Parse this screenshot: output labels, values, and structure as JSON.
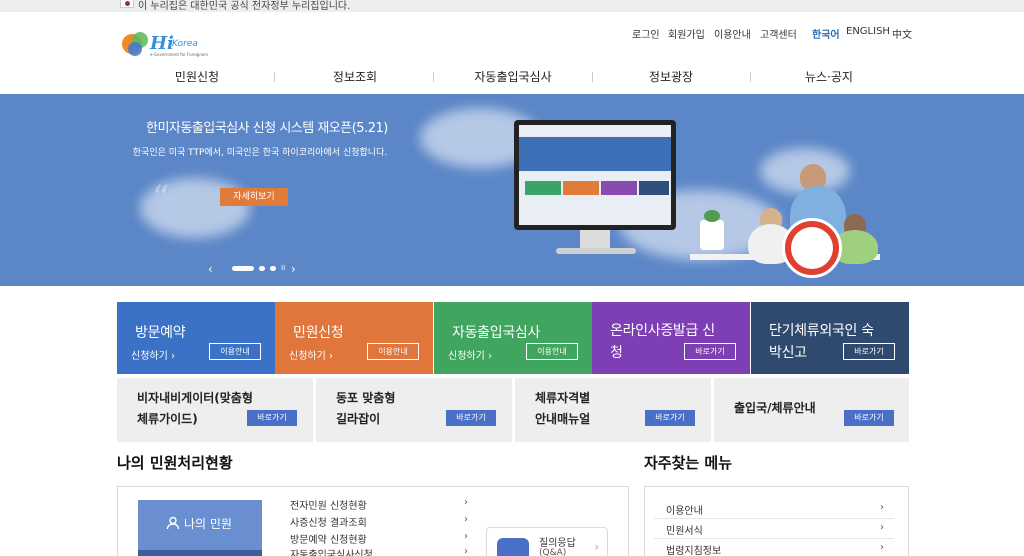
{
  "gov_notice": "이 누리집은 대한민국 공식 전자정부 누리집입니다.",
  "logo": {
    "mark": "Hi",
    "name": "Korea",
    "tagline": "e-Government for Foreigners"
  },
  "utility_links": [
    "로그인",
    "회원가입",
    "이용안내",
    "고객센터"
  ],
  "languages": [
    "한국어",
    "ENGLISH",
    "中文"
  ],
  "active_language": "한국어",
  "gnb": [
    "민원신청",
    "정보조회",
    "자동출입국심사",
    "정보광장",
    "뉴스·공지"
  ],
  "hero": {
    "title": "한미자동출입국심사 신청 시스템 재오픈(5.21)",
    "description": "한국인은 미국 TTP에서, 미국인은 한국 하이코리아에서 신청합니다.",
    "button": "자세히보기",
    "prev": "‹",
    "next": "›",
    "pause": "II",
    "slide_count": 3,
    "active_slide": 1
  },
  "tiles": [
    {
      "title": "방문예약",
      "link": "신청하기 ›",
      "button": "이용안내",
      "color": "#3b72c6"
    },
    {
      "title": "민원신청",
      "link": "신청하기 ›",
      "button": "이용안내",
      "color": "#e0763b"
    },
    {
      "title": "자동출입국심사",
      "link": "신청하기 ›",
      "button": "이용안내",
      "color": "#3fa55f"
    },
    {
      "title": "온라인사증발급 신청",
      "link": "",
      "button": "바로가기",
      "color": "#7f3fb4"
    },
    {
      "title": "단기체류외국인 숙박신고",
      "link": "",
      "button": "바로가기",
      "color": "#2f4a6e"
    }
  ],
  "guides": [
    {
      "title": [
        "비자내비게이터(맞춤형",
        "체류가이드)"
      ],
      "button": "바로가기"
    },
    {
      "title": [
        "동포 맞춤형",
        "길라잡이"
      ],
      "button": "바로가기"
    },
    {
      "title": [
        "체류자격별",
        "안내매뉴얼"
      ],
      "button": "바로가기"
    },
    {
      "title": [
        "출입국/체류안내"
      ],
      "button": "바로가기"
    }
  ],
  "my_status": {
    "title": "나의 민원처리현황",
    "card_label": "나의 민원",
    "services": [
      "전자민원 신청현황",
      "사증신청 결과조회",
      "방문예약 신청현황",
      "자동출입국심사신청"
    ],
    "qa_label": "질의응답",
    "qa_sub": "(Q&A)"
  },
  "faq_menu": {
    "title": "자주찾는 메뉴",
    "items": [
      "이용안내",
      "민원서식",
      "법령지침정보"
    ]
  },
  "colors": {
    "accent": "#2a6db5",
    "hero_bg": "#5b86c7",
    "guide_btn": "#4a6fc7"
  },
  "icons": [
    "korea-flag-icon",
    "chevron-right-icon",
    "user-icon",
    "chat-icon"
  ]
}
